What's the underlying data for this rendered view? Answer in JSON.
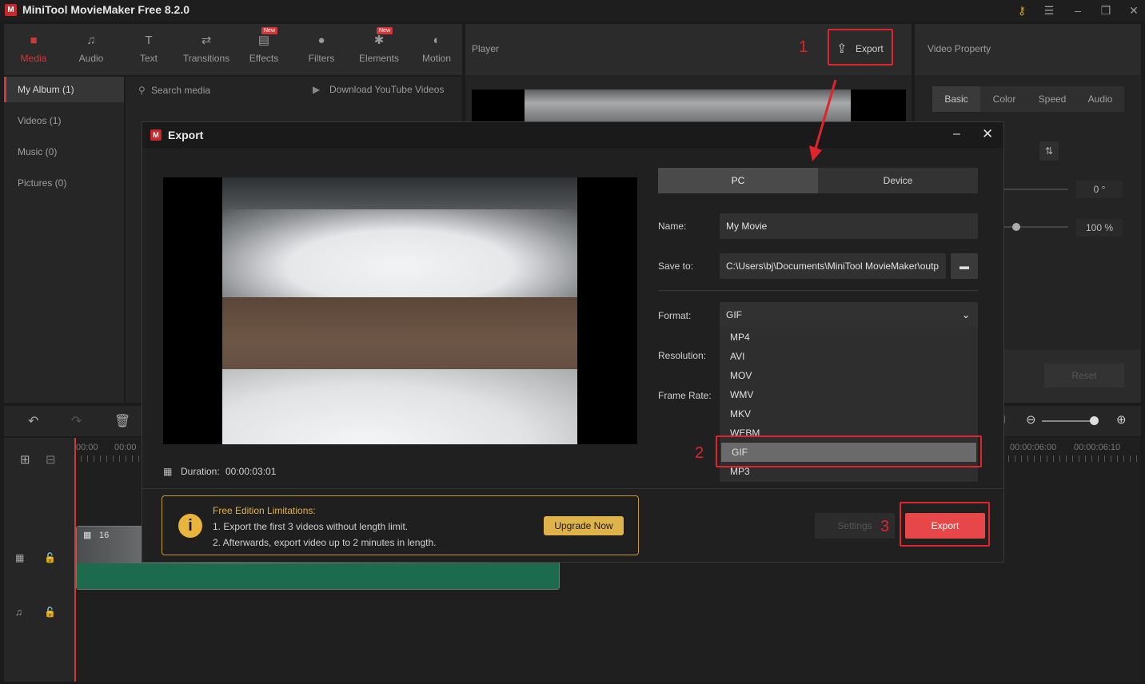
{
  "app": {
    "title": "MiniTool MovieMaker Free 8.2.0",
    "logo_letter": "M"
  },
  "toolbar": {
    "tools": [
      {
        "label": "Media",
        "icon": "folder-icon"
      },
      {
        "label": "Audio",
        "icon": "music-note-icon"
      },
      {
        "label": "Text",
        "icon": "text-icon"
      },
      {
        "label": "Transitions",
        "icon": "swap-arrows-icon"
      },
      {
        "label": "Effects",
        "icon": "effects-icon",
        "badge": "New"
      },
      {
        "label": "Filters",
        "icon": "filters-icon"
      },
      {
        "label": "Elements",
        "icon": "elements-icon",
        "badge": "New"
      },
      {
        "label": "Motion",
        "icon": "motion-icon"
      }
    ]
  },
  "album": {
    "items": [
      "My Album (1)",
      "Videos (1)",
      "Music (0)",
      "Pictures (0)"
    ]
  },
  "media": {
    "search_placeholder": "Search media",
    "download_label": "Download YouTube Videos"
  },
  "player": {
    "title": "Player",
    "export_label": "Export"
  },
  "property": {
    "title": "Video Property",
    "tabs": [
      "Basic",
      "Color",
      "Speed",
      "Audio"
    ],
    "rotation_value": "0 °",
    "scale_value": "100 %",
    "reset_label": "Reset"
  },
  "timeline": {
    "ticks_left": [
      "00:00",
      "00:00"
    ],
    "ticks_right": [
      "00:00:06:00",
      "00:00:06:10"
    ],
    "clip_label": "16"
  },
  "dialog": {
    "title": "Export",
    "tabs": [
      "PC",
      "Device"
    ],
    "name_label": "Name:",
    "name_value": "My Movie",
    "save_label": "Save to:",
    "save_value": "C:\\Users\\bj\\Documents\\MiniTool MovieMaker\\outp",
    "format_label": "Format:",
    "format_value": "GIF",
    "resolution_label": "Resolution:",
    "framerate_label": "Frame Rate:",
    "format_options": [
      "MP4",
      "AVI",
      "MOV",
      "WMV",
      "MKV",
      "WEBM",
      "GIF",
      "MP3"
    ],
    "duration_label": "Duration:",
    "duration_value": "00:00:03:01",
    "limit_title": "Free Edition Limitations:",
    "limit_line1": "1. Export the first 3 videos without length limit.",
    "limit_line2": "2. Afterwards, export video up to 2 minutes in length.",
    "upgrade_label": "Upgrade Now",
    "settings_label": "Settings",
    "export_label": "Export"
  },
  "annotations": {
    "step1": "1",
    "step2": "2",
    "step3": "3",
    "color": "#e1232b"
  }
}
